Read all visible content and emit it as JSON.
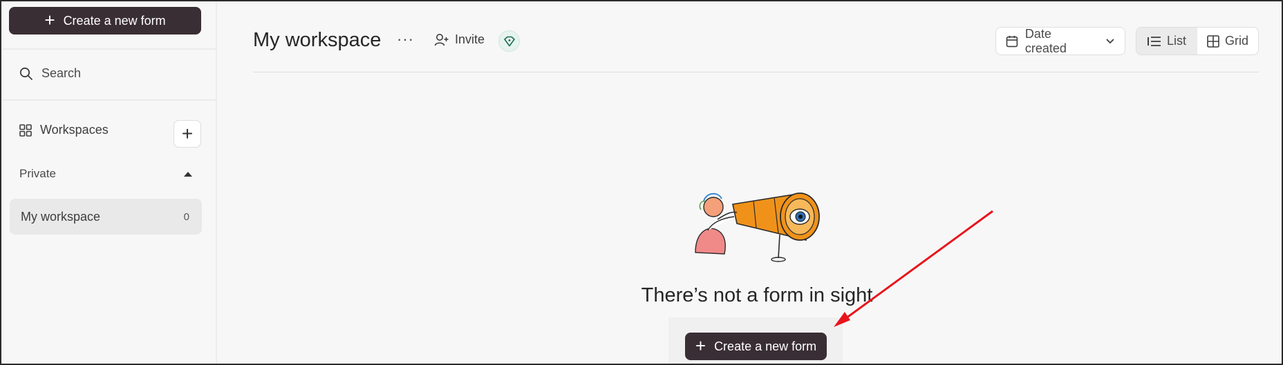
{
  "sidebar": {
    "create_label": "Create a new form",
    "search_label": "Search",
    "workspaces_label": "Workspaces",
    "private_label": "Private",
    "workspace_items": [
      {
        "label": "My workspace",
        "count": "0"
      }
    ]
  },
  "header": {
    "title": "My workspace",
    "more_label": "···",
    "invite_label": "Invite",
    "sort_label": "Date created",
    "view_list_label": "List",
    "view_grid_label": "Grid"
  },
  "empty_state": {
    "title": "There’s not a form in sight",
    "create_label": "Create a new form"
  },
  "icons": {
    "plus": "plus-icon",
    "search": "search-icon",
    "workspaces": "grid-icon",
    "invite": "add-user-icon",
    "diamond": "diamond-icon",
    "calendar": "calendar-icon",
    "list": "list-icon",
    "grid": "grid-view-icon"
  },
  "colors": {
    "primary_button": "#3a2e35",
    "annotation_arrow": "#e8141b",
    "telescope": "#f0921a"
  }
}
